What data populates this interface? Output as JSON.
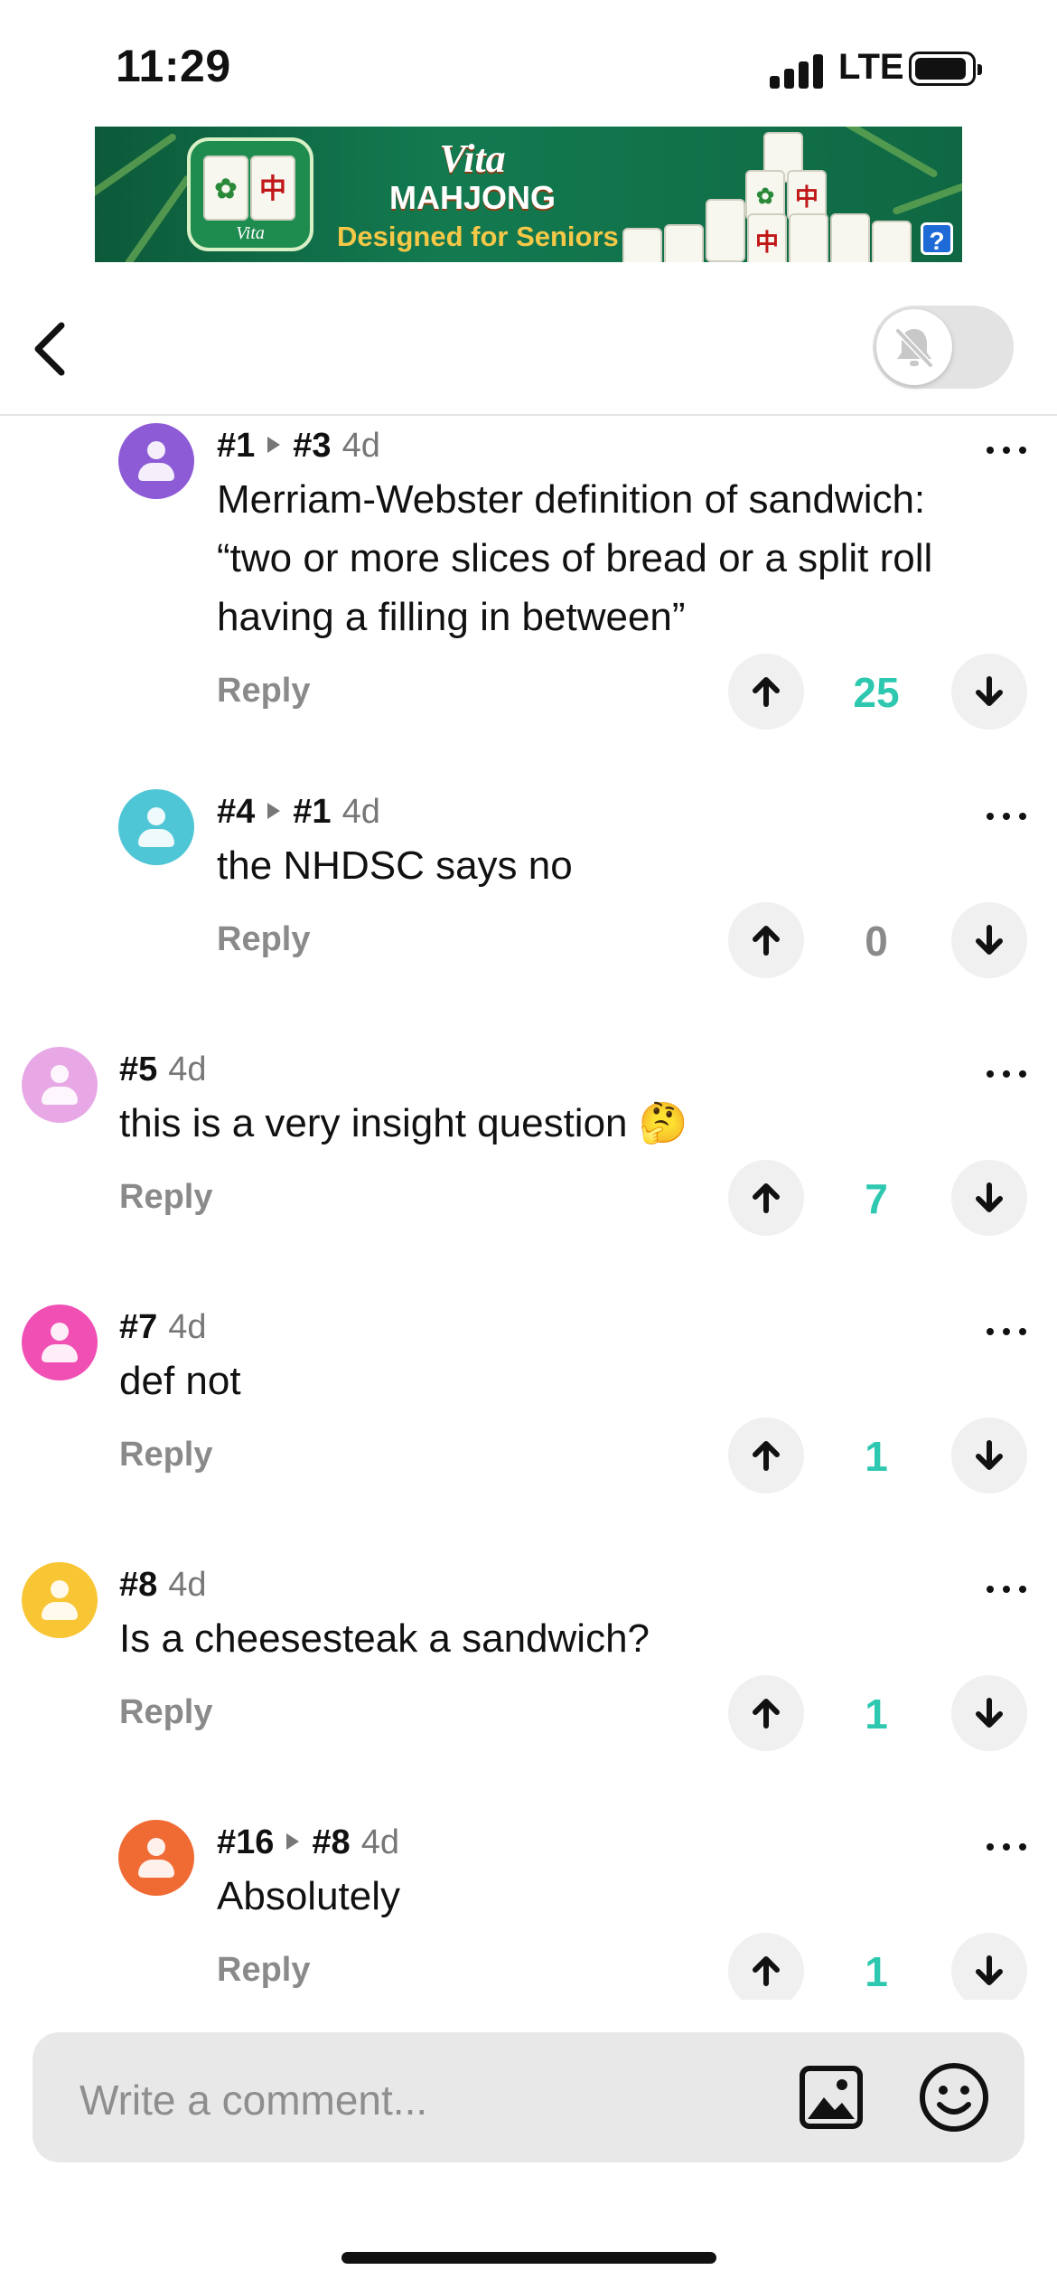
{
  "status_bar": {
    "time": "11:29",
    "network": "LTE"
  },
  "ad": {
    "brand_line1": "Vita",
    "brand_line2": "MAHJONG",
    "tagline": "Designed for Seniors",
    "icon_label": "Vita",
    "help": "?"
  },
  "header": {
    "back_icon": "chevron-left-icon",
    "notifications_toggle": "off",
    "toggle_icon": "bell-slash-icon"
  },
  "comments": [
    {
      "id": "#1",
      "reply_to": "#3",
      "age": "4d",
      "lines": [
        "Merriam-Webster definition of sandwich:",
        "“two or more slices of bread or a split roll",
        "having a filling in between”"
      ],
      "reply_label": "Reply",
      "score": "25",
      "avatar_color": "#8e5bd6"
    },
    {
      "id": "#4",
      "reply_to": "#1",
      "age": "4d",
      "lines": [
        "the NHDSC says no"
      ],
      "reply_label": "Reply",
      "score": "0",
      "avatar_color": "#4fc6d6"
    },
    {
      "id": "#5",
      "reply_to": "",
      "age": "4d",
      "lines": [
        "this is a very insight question 🤔"
      ],
      "reply_label": "Reply",
      "score": "7",
      "avatar_color": "#e8a8e6"
    },
    {
      "id": "#7",
      "reply_to": "",
      "age": "4d",
      "lines": [
        "def not"
      ],
      "reply_label": "Reply",
      "score": "1",
      "avatar_color": "#f04fb4"
    },
    {
      "id": "#8",
      "reply_to": "",
      "age": "4d",
      "lines": [
        "Is a cheesesteak a sandwich?"
      ],
      "reply_label": "Reply",
      "score": "1",
      "avatar_color": "#f8c534"
    },
    {
      "id": "#16",
      "reply_to": "#8",
      "age": "4d",
      "lines": [
        "Absolutely"
      ],
      "reply_label": "Reply",
      "score": "1",
      "avatar_color": "#f06a34"
    }
  ],
  "colors": {
    "score_positive": "#2ec8b0",
    "score_zero": "#8a8a8a"
  },
  "composer": {
    "placeholder": "Write a comment...",
    "image_icon": "image-icon",
    "emoji_icon": "emoji-icon"
  }
}
